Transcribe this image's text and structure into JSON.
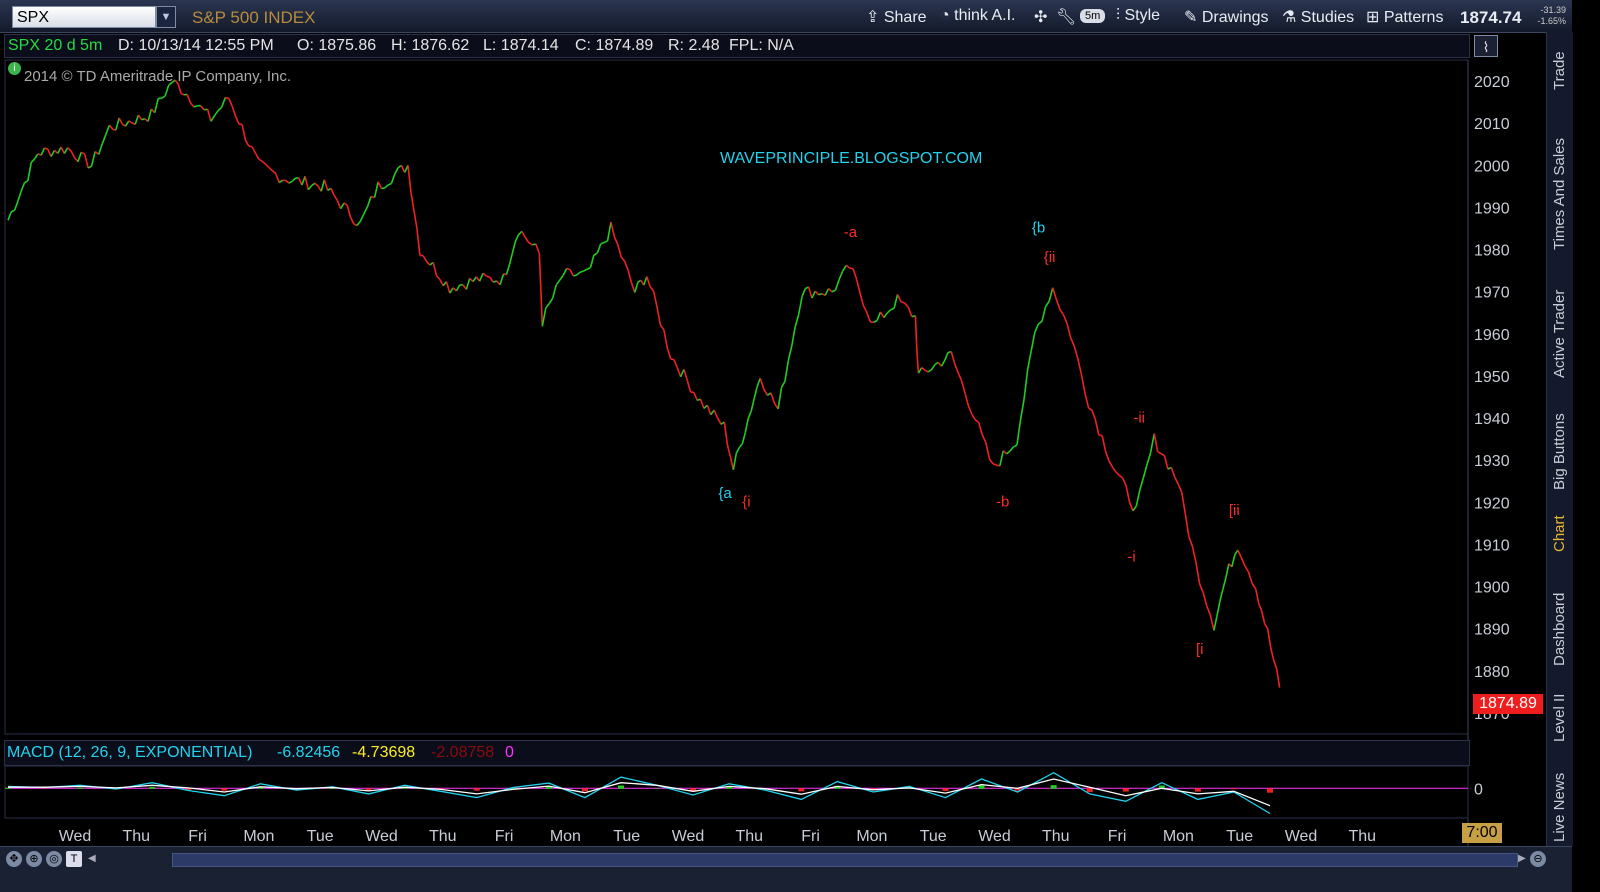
{
  "toolbar": {
    "symbol": "SPX",
    "symbol_name": "S&P 500 INDEX",
    "share": "Share",
    "think_ai": "think A.I.",
    "interval_badge": "5m",
    "style": "Style",
    "drawings": "Drawings",
    "studies": "Studies",
    "patterns": "Patterns",
    "last_price": "1874.74",
    "net_change": "-31.39",
    "pct_change": "-1.65%"
  },
  "infobar": {
    "study": "SPX 20 d 5m",
    "date": "D: 10/13/14 12:55 PM",
    "open": "O: 1875.86",
    "high": "H: 1876.62",
    "low": "L: 1874.14",
    "close": "C: 1874.89",
    "range": "R: 2.48",
    "fpl": "FPL: N/A"
  },
  "copyright": "2014 © TD Ameritrade IP Company, Inc.",
  "watermark": "WAVEPRINCIPLE.BLOGSPOT.COM",
  "price_tag": "1874.89",
  "macd": {
    "label": "MACD (12, 26, 9, EXPONENTIAL)",
    "value": "-6.82456",
    "avg": "-4.73698",
    "diff": "-2.08758",
    "zero": "0"
  },
  "time_box": "7:00",
  "sidebar_tabs": [
    "Trade",
    "Times And Sales",
    "Active Trader",
    "Big Buttons",
    "Chart",
    "Dashboard",
    "Level II",
    "Live News"
  ],
  "colors": {
    "up": "#22cc22",
    "down": "#ee2222",
    "cyan_label": "#22d3ee",
    "red_label": "#ff2a2a",
    "accent": "#c7a046"
  },
  "chart_data": {
    "type": "line",
    "symbol": "SPX",
    "ylim": [
      1865,
      2025
    ],
    "yticks": [
      2020,
      2010,
      2000,
      1990,
      1980,
      1970,
      1960,
      1950,
      1940,
      1930,
      1920,
      1910,
      1900,
      1890,
      1880,
      1870
    ],
    "x": [
      "Wed",
      "Thu",
      "Fri",
      "Mon",
      "Tue",
      "Wed",
      "Thu",
      "Fri",
      "Mon",
      "Tue",
      "Wed",
      "Thu",
      "Fri",
      "Mon",
      "Tue",
      "Wed",
      "Thu",
      "Fri",
      "Mon",
      "Tue",
      "Wed",
      "Thu"
    ],
    "y_path": [
      [
        0,
        1987
      ],
      [
        0.5,
        2003
      ],
      [
        1.0,
        2004
      ],
      [
        1.4,
        2000
      ],
      [
        1.7,
        2009
      ],
      [
        2.4,
        2012
      ],
      [
        2.75,
        2020
      ],
      [
        3.0,
        2017
      ],
      [
        3.4,
        2011
      ],
      [
        3.7,
        2016
      ],
      [
        4.2,
        2000
      ],
      [
        4.6,
        1997
      ],
      [
        5.3,
        1995
      ],
      [
        5.9,
        1986
      ],
      [
        6.2,
        1995
      ],
      [
        6.7,
        2000
      ],
      [
        6.9,
        1980
      ],
      [
        7.4,
        1971
      ],
      [
        7.9,
        1973
      ],
      [
        8.3,
        1973
      ],
      [
        8.55,
        1985
      ],
      [
        8.9,
        1979
      ],
      [
        8.95,
        1963
      ],
      [
        9.3,
        1974
      ],
      [
        9.7,
        1974
      ],
      [
        10.1,
        1985
      ],
      [
        10.5,
        1970
      ],
      [
        10.7,
        1974
      ],
      [
        11.1,
        1955
      ],
      [
        11.6,
        1944
      ],
      [
        12.0,
        1938
      ],
      [
        12.15,
        1928
      ],
      [
        12.4,
        1940
      ],
      [
        12.6,
        1950
      ],
      [
        12.9,
        1942
      ],
      [
        13.3,
        1970
      ],
      [
        13.8,
        1970
      ],
      [
        14.1,
        1976
      ],
      [
        14.5,
        1962
      ],
      [
        14.9,
        1968
      ],
      [
        15.2,
        1964
      ],
      [
        15.25,
        1950
      ],
      [
        15.8,
        1955
      ],
      [
        16.2,
        1940
      ],
      [
        16.5,
        1928
      ],
      [
        16.9,
        1935
      ],
      [
        17.2,
        1960
      ],
      [
        17.5,
        1971
      ],
      [
        17.8,
        1960
      ],
      [
        18.1,
        1944
      ],
      [
        18.5,
        1929
      ],
      [
        18.9,
        1918
      ],
      [
        19.2,
        1935
      ],
      [
        19.6,
        1925
      ],
      [
        19.9,
        1905
      ],
      [
        20.2,
        1891
      ],
      [
        20.4,
        1902
      ],
      [
        20.6,
        1910
      ],
      [
        20.9,
        1900
      ],
      [
        21.1,
        1889
      ],
      [
        21.3,
        1876
      ]
    ],
    "labels": [
      {
        "text": "{a",
        "x": 11.9,
        "y": 1921,
        "color": "cyan"
      },
      {
        "text": "{i",
        "x": 12.3,
        "y": 1919,
        "color": "red"
      },
      {
        "text": "-a",
        "x": 14.0,
        "y": 1983,
        "color": "red"
      },
      {
        "text": "{b",
        "x": 17.15,
        "y": 1984,
        "color": "cyan"
      },
      {
        "text": "{ii",
        "x": 17.35,
        "y": 1977,
        "color": "red"
      },
      {
        "text": "-b",
        "x": 16.55,
        "y": 1919,
        "color": "red"
      },
      {
        "text": "-ii",
        "x": 18.85,
        "y": 1939,
        "color": "red"
      },
      {
        "text": "-i",
        "x": 18.75,
        "y": 1906,
        "color": "red"
      },
      {
        "text": "[i",
        "x": 19.9,
        "y": 1884,
        "color": "red"
      },
      {
        "text": "[ii",
        "x": 20.45,
        "y": 1917,
        "color": "red"
      }
    ],
    "macd_series": [
      {
        "name": "value",
        "values": [
          0.5,
          0.2,
          0.8,
          -0.2,
          1.5,
          -0.6,
          -2,
          1.2,
          -0.5,
          0.4,
          -1.5,
          0.8,
          -0.8,
          -2.5,
          0.2,
          1.4,
          -2.5,
          3,
          0.8,
          -1.8,
          1.2,
          -0.5,
          -3,
          1.8,
          -1,
          0.5,
          -2.5,
          2.5,
          -1,
          4.2,
          -1.5,
          -3.5,
          1.5,
          -3,
          -1,
          -6.8
        ]
      },
      {
        "name": "avg",
        "values": [
          0.3,
          0.3,
          0.5,
          0.1,
          0.8,
          0.1,
          -1,
          0.4,
          -0.1,
          0.2,
          -0.7,
          0.3,
          -0.3,
          -1.5,
          -0.3,
          0.6,
          -1.2,
          1.5,
          0.8,
          -0.8,
          0.5,
          -0.1,
          -1.6,
          0.5,
          -0.4,
          0.1,
          -1.3,
          1,
          0,
          2.5,
          0.3,
          -2,
          0,
          -1.5,
          -0.8,
          -4.7
        ]
      }
    ],
    "macd_ylim": [
      -8,
      6
    ]
  }
}
